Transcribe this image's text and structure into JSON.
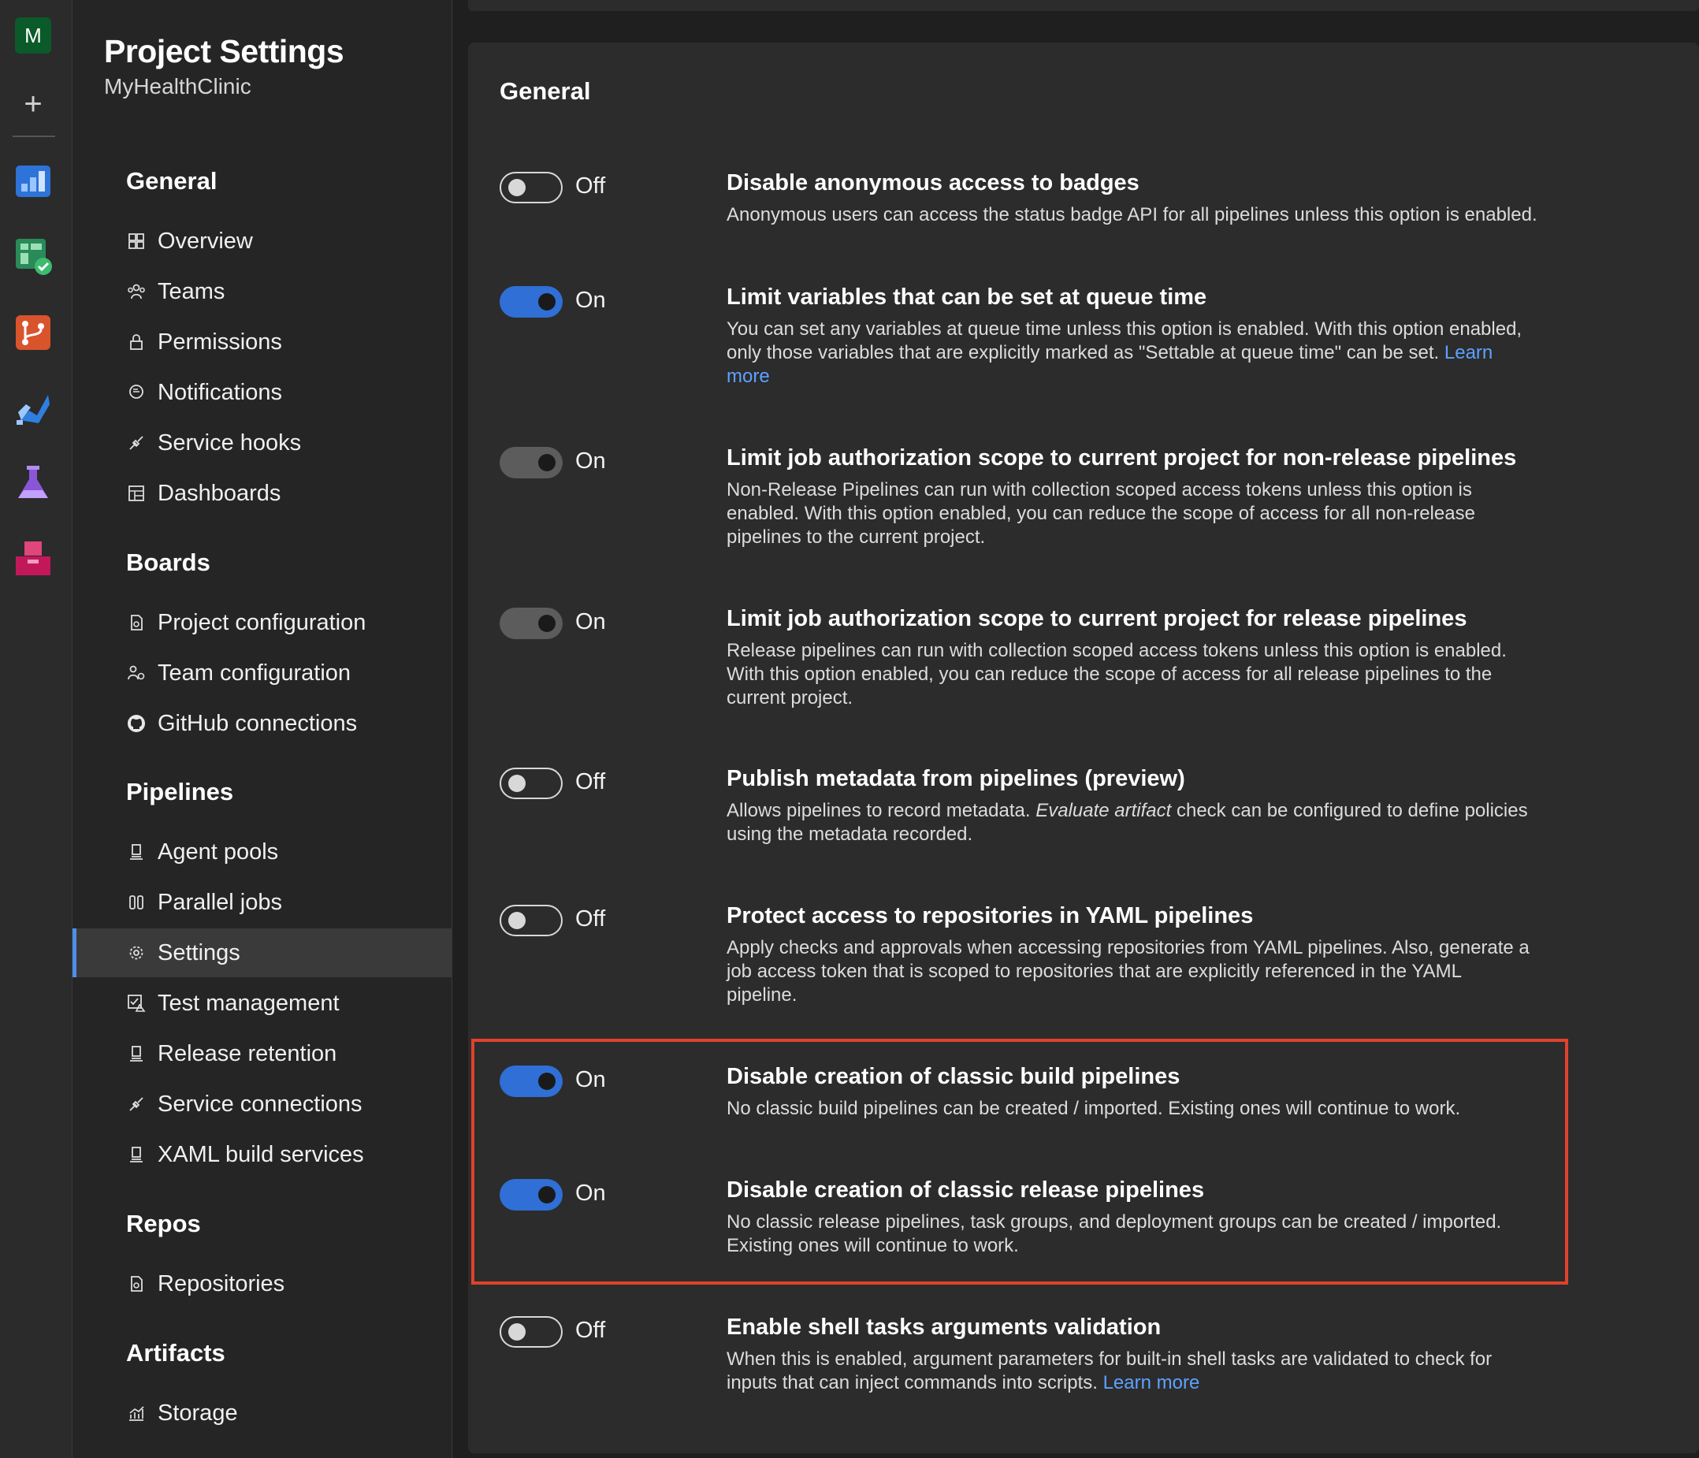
{
  "rail": {
    "avatar_letter": "M",
    "add_glyph": "+",
    "icons": [
      "overview-icon",
      "boards-icon",
      "repos-icon",
      "pipelines-icon",
      "test-plans-icon",
      "artifacts-icon"
    ]
  },
  "nav": {
    "title": "Project Settings",
    "subtitle": "MyHealthClinic",
    "sections": {
      "general": "General",
      "boards": "Boards",
      "pipelines": "Pipelines",
      "repos": "Repos",
      "artifacts": "Artifacts"
    },
    "items": {
      "overview": "Overview",
      "teams": "Teams",
      "permissions": "Permissions",
      "notifications": "Notifications",
      "service_hooks": "Service hooks",
      "dashboards": "Dashboards",
      "project_configuration": "Project configuration",
      "team_configuration": "Team configuration",
      "github_connections": "GitHub connections",
      "agent_pools": "Agent pools",
      "parallel_jobs": "Parallel jobs",
      "settings": "Settings",
      "test_management": "Test management",
      "release_retention": "Release retention",
      "service_connections": "Service connections",
      "xaml_build_services": "XAML build services",
      "repositories": "Repositories",
      "storage": "Storage"
    },
    "selected": "Settings"
  },
  "main": {
    "heading": "General",
    "rows": [
      {
        "state": "Off",
        "title": "Disable anonymous access to badges",
        "desc": "Anonymous users can access the status badge API for all pipelines unless this option is enabled."
      },
      {
        "state": "On",
        "title": "Limit variables that can be set at queue time",
        "desc_line1": "You can set any variables at queue time unless this option is enabled. With this option enabled,",
        "desc_line2": "only those variables that are explicitly marked as \"Settable at queue time\" can be set.",
        "link1": "Learn",
        "link2": "more"
      },
      {
        "state": "On",
        "title": "Limit job authorization scope to current project for non-release pipelines",
        "desc_line1": "Non-Release Pipelines can run with collection scoped access tokens unless this option is",
        "desc_line2": "enabled. With this option enabled, you can reduce the scope of access for all non-release",
        "desc_line3": "pipelines to the current project."
      },
      {
        "state": "On",
        "title": "Limit job authorization scope to current project for release pipelines",
        "desc_line1": "Release pipelines can run with collection scoped access tokens unless this option is enabled.",
        "desc_line2": "With this option enabled, you can reduce the scope of access for all release pipelines to the",
        "desc_line3": "current project."
      },
      {
        "state": "Off",
        "title": "Publish metadata from pipelines (preview)",
        "desc_pre": "Allows pipelines to record metadata.",
        "desc_em": "Evaluate artifact",
        "desc_post": "check can be configured to define policies",
        "desc_line2": "using the metadata recorded."
      },
      {
        "state": "Off",
        "title": "Protect access to repositories in YAML pipelines",
        "desc_line1": "Apply checks and approvals when accessing repositories from YAML pipelines. Also, generate a",
        "desc_line2": "job access token that is scoped to repositories that are explicitly referenced in the YAML",
        "desc_line3": "pipeline."
      },
      {
        "state": "On",
        "title": "Disable creation of classic build pipelines",
        "desc": "No classic build pipelines can be created / imported. Existing ones will continue to work."
      },
      {
        "state": "On",
        "title": "Disable creation of classic release pipelines",
        "desc_line1": "No classic release pipelines, task groups, and deployment groups can be created / imported.",
        "desc_line2": "Existing ones will continue to work."
      },
      {
        "state": "Off",
        "title": "Enable shell tasks arguments validation",
        "desc_line1": "When this is enabled, argument parameters for built-in shell tasks are validated to check for",
        "desc_line2": "inputs that can inject commands into scripts.",
        "link": "Learn more"
      }
    ]
  },
  "colors": {
    "accent": "#2f6fd6",
    "link": "#5ea1ff",
    "highlight_border": "#e0422b",
    "panel": "#2c2c2c",
    "nav_bg": "#252525"
  }
}
